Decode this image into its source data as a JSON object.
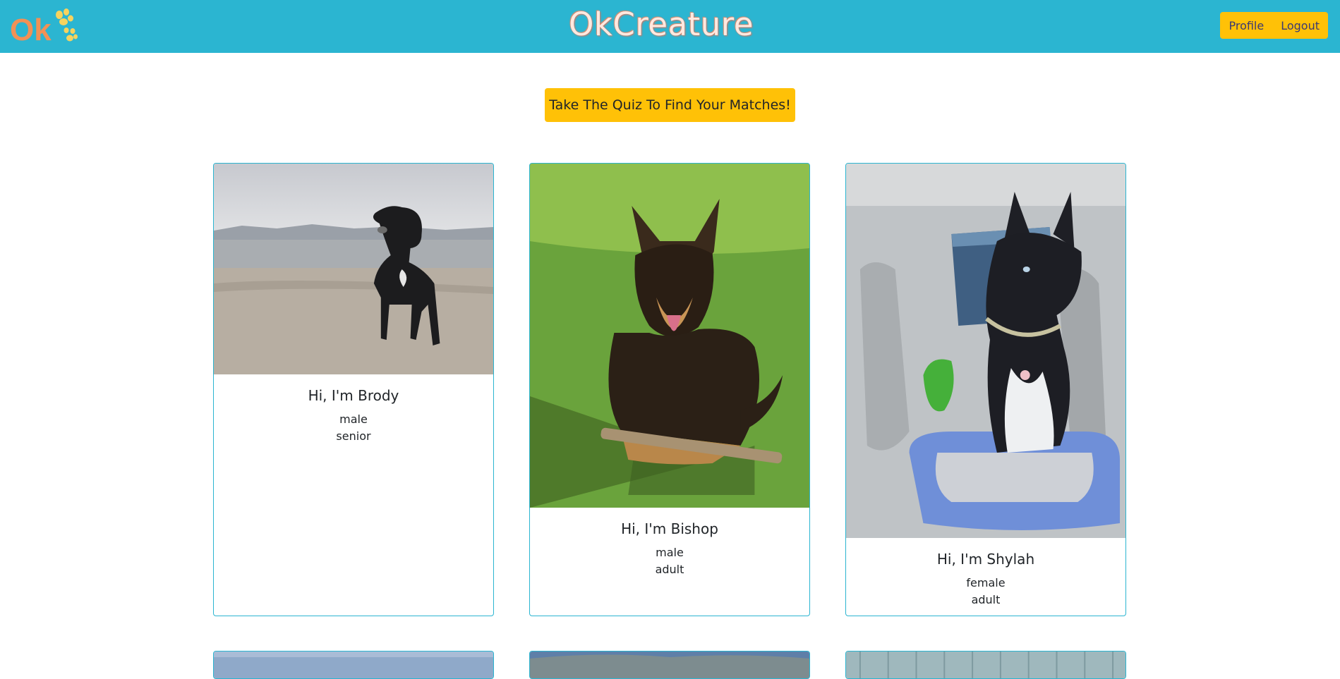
{
  "navbar": {
    "logo_text": "OK",
    "brand": "OkCreature",
    "buttons": {
      "profile": "Profile",
      "logout": "Logout"
    }
  },
  "quiz_button": "Take The Quiz To Find Your Matches!",
  "cards": [
    {
      "greeting": "Hi, I'm Brody",
      "sex": "male",
      "age": "senior"
    },
    {
      "greeting": "Hi, I'm Bishop",
      "sex": "male",
      "age": "adult"
    },
    {
      "greeting": "Hi, I'm Shylah",
      "sex": "female",
      "age": "adult"
    }
  ],
  "colors": {
    "navbar": "#2bb5d1",
    "accent_button": "#ffc107",
    "card_border": "#2bb5d1",
    "logo_orange": "#f29155",
    "logo_yellow": "#f6d35e"
  }
}
